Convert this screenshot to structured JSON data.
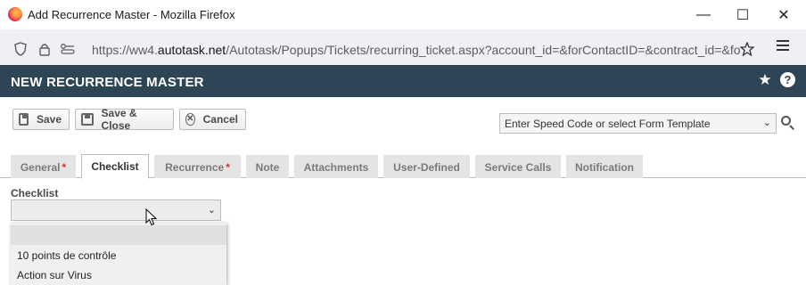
{
  "browser": {
    "window_title": "Add Recurrence Master - Mozilla Firefox",
    "url_prefix": "https://ww4.",
    "url_domain": "autotask.net",
    "url_path": "/Autotask/Popups/Tickets/recurring_ticket.aspx?account_id=&forContactID=&contract_id=&fo",
    "controls": {
      "minimize": "—",
      "maximize": "☐",
      "close": "✕"
    }
  },
  "header": {
    "title": "NEW RECURRENCE MASTER"
  },
  "toolbar": {
    "save_label": "Save",
    "save_close_label": "Save & Close",
    "cancel_label": "Cancel",
    "speed_code_placeholder": "Enter Speed Code or select Form Template"
  },
  "tabs": [
    {
      "label": "General",
      "required": true
    },
    {
      "label": "Checklist",
      "required": false,
      "active": true
    },
    {
      "label": "Recurrence",
      "required": true
    },
    {
      "label": "Note",
      "required": false
    },
    {
      "label": "Attachments",
      "required": false
    },
    {
      "label": "User-Defined",
      "required": false
    },
    {
      "label": "Service Calls",
      "required": false
    },
    {
      "label": "Notification",
      "required": false
    }
  ],
  "required_mark": "*",
  "checklist": {
    "label": "Checklist",
    "selected_value": "",
    "options": [
      "",
      "10 points de contrôle",
      "Action sur Virus"
    ]
  },
  "colors": {
    "header_bg": "#2e4556",
    "required": "#d12f2f"
  }
}
